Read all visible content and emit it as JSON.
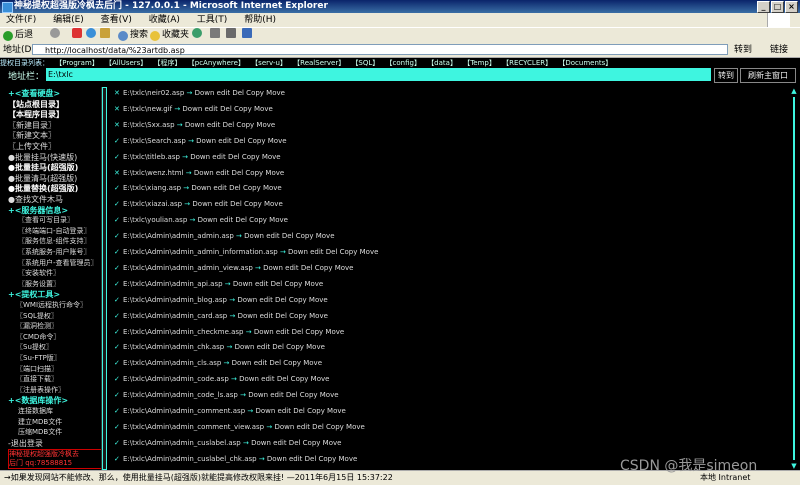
{
  "window": {
    "title": "神秘提权超强版冷枫去后门 - 127.0.0.1 - Microsoft Internet Explorer",
    "controls": [
      "_",
      "□",
      "×"
    ]
  },
  "menu": [
    "文件(F)",
    "编辑(E)",
    "查看(V)",
    "收藏(A)",
    "工具(T)",
    "帮助(H)"
  ],
  "toolbar": {
    "back": "后退",
    "search": "搜索",
    "favorites": "收藏夹"
  },
  "address": {
    "label": "地址(D)",
    "url": "http://localhost/data/%23artdb.asp",
    "go": "转到",
    "links": "链接"
  },
  "dirbar": {
    "label": "提权目录列表：",
    "items": [
      "【Program】",
      "【AllUsers】",
      "【程序】",
      "【pcAnywhere】",
      "【serv-u】",
      "【RealServer】",
      "【SQL】",
      "【config】",
      "【data】",
      "【Temp】",
      "【RECYCLER】",
      "【Documents】"
    ]
  },
  "pathbar": {
    "label": "地址栏：",
    "value": "E:\\txlc",
    "go": "转到",
    "refresh": "刷新主窗口"
  },
  "sidebar": {
    "items": [
      {
        "text": "+<查看硬盘>",
        "kind": "sec"
      },
      {
        "text": "【站点根目录】",
        "kind": "bold"
      },
      {
        "text": "【本程序目录】",
        "kind": "bold"
      },
      {
        "text": "〖新建目录〗",
        "kind": "item"
      },
      {
        "text": "〖新建文本〗",
        "kind": "item"
      },
      {
        "text": "〖上传文件〗",
        "kind": "item"
      },
      {
        "text": "●批量挂马(快速版)",
        "kind": "item"
      },
      {
        "text": "●批量挂马(超强版)",
        "kind": "bold"
      },
      {
        "text": "●批量清马(超强版)",
        "kind": "item"
      },
      {
        "text": "●批量替换(超强版)",
        "kind": "bold"
      },
      {
        "text": "●查找文件木马",
        "kind": "item"
      },
      {
        "text": "+<服务器信息>",
        "kind": "sec"
      },
      {
        "text": "〖查看可写目录〗",
        "kind": "sub"
      },
      {
        "text": "〖终端端口-自动登录〗",
        "kind": "sub"
      },
      {
        "text": "〖服务信息-组件支持〗",
        "kind": "sub"
      },
      {
        "text": "〖系统服务-用户账号〗",
        "kind": "sub"
      },
      {
        "text": "〖系统用户-查看管理员〗",
        "kind": "sub"
      },
      {
        "text": "〖安装软件〗",
        "kind": "sub"
      },
      {
        "text": "〖服务设置〗",
        "kind": "sub"
      },
      {
        "text": "+<提权工具>",
        "kind": "sec"
      },
      {
        "text": "〖WMI远程执行命令〗",
        "kind": "sub2"
      },
      {
        "text": "〖SQL提权〗",
        "kind": "sub2"
      },
      {
        "text": "〖漏洞检测〗",
        "kind": "sub2"
      },
      {
        "text": "〖CMD命令〗",
        "kind": "sub2"
      },
      {
        "text": "〖Su提权〗",
        "kind": "sub2"
      },
      {
        "text": "〖Su-FTP版〗",
        "kind": "sub2"
      },
      {
        "text": "〖端口扫描〗",
        "kind": "sub2"
      },
      {
        "text": "〖直接下载〗",
        "kind": "sub2"
      },
      {
        "text": "〖注册表操作〗",
        "kind": "sub2"
      },
      {
        "text": "+<数据库操作>",
        "kind": "sec"
      },
      {
        "text": "连接数据库",
        "kind": "sub"
      },
      {
        "text": "建立MDB文件",
        "kind": "sub"
      },
      {
        "text": "压缩MDB文件",
        "kind": "sub"
      },
      {
        "text": "-退出登录",
        "kind": "item"
      }
    ],
    "footer": [
      "神秘提权超强版冷枫去",
      "后门 qq:78588815"
    ]
  },
  "files": [
    {
      "mark": "✕",
      "path": "E:\\txlc\\neir02.asp",
      "ops": "Down edit Del Copy Move"
    },
    {
      "mark": "✕",
      "path": "E:\\txlc\\new.gif",
      "ops": "Down edit Del Copy Move"
    },
    {
      "mark": "✕",
      "path": "E:\\txlc\\Sxx.asp",
      "ops": "Down edit Del Copy Move"
    },
    {
      "mark": "✓",
      "path": "E:\\txlc\\Search.asp",
      "ops": "Down edit Del Copy Move"
    },
    {
      "mark": "✓",
      "path": "E:\\txlc\\titleb.asp",
      "ops": "Down edit Del Copy Move"
    },
    {
      "mark": "✕",
      "path": "E:\\txlc\\wenz.html",
      "ops": "Down edit Del Copy Move"
    },
    {
      "mark": "✓",
      "path": "E:\\txlc\\xiang.asp",
      "ops": "Down edit Del Copy Move"
    },
    {
      "mark": "✓",
      "path": "E:\\txlc\\xiazai.asp",
      "ops": "Down edit Del Copy Move"
    },
    {
      "mark": "✓",
      "path": "E:\\txlc\\youlian.asp",
      "ops": "Down edit Del Copy Move"
    },
    {
      "mark": "✓",
      "path": "E:\\txlc\\Admin\\admin_admin.asp",
      "ops": "Down edit Del Copy Move"
    },
    {
      "mark": "✓",
      "path": "E:\\txlc\\Admin\\admin_admin_information.asp",
      "ops": "Down edit Del Copy Move"
    },
    {
      "mark": "✓",
      "path": "E:\\txlc\\Admin\\admin_admin_view.asp",
      "ops": "Down edit Del Copy Move"
    },
    {
      "mark": "✓",
      "path": "E:\\txlc\\Admin\\admin_api.asp",
      "ops": "Down edit Del Copy Move"
    },
    {
      "mark": "✓",
      "path": "E:\\txlc\\Admin\\admin_blog.asp",
      "ops": "Down edit Del Copy Move"
    },
    {
      "mark": "✓",
      "path": "E:\\txlc\\Admin\\admin_card.asp",
      "ops": "Down edit Del Copy Move"
    },
    {
      "mark": "✓",
      "path": "E:\\txlc\\Admin\\admin_checkme.asp",
      "ops": "Down edit Del Copy Move"
    },
    {
      "mark": "✓",
      "path": "E:\\txlc\\Admin\\admin_chk.asp",
      "ops": "Down edit Del Copy Move"
    },
    {
      "mark": "✓",
      "path": "E:\\txlc\\Admin\\admin_cls.asp",
      "ops": "Down edit Del Copy Move"
    },
    {
      "mark": "✓",
      "path": "E:\\txlc\\Admin\\admin_code.asp",
      "ops": "Down edit Del Copy Move"
    },
    {
      "mark": "✓",
      "path": "E:\\txlc\\Admin\\admin_code_ls.asp",
      "ops": "Down edit Del Copy Move"
    },
    {
      "mark": "✓",
      "path": "E:\\txlc\\Admin\\admin_comment.asp",
      "ops": "Down edit Del Copy Move"
    },
    {
      "mark": "✓",
      "path": "E:\\txlc\\Admin\\admin_comment_view.asp",
      "ops": "Down edit Del Copy Move"
    },
    {
      "mark": "✓",
      "path": "E:\\txlc\\Admin\\admin_cuslabel.asp",
      "ops": "Down edit Del Copy Move"
    },
    {
      "mark": "✓",
      "path": "E:\\txlc\\Admin\\admin_cuslabel_chk.asp",
      "ops": "Down edit Del Copy Move"
    }
  ],
  "statusbar": {
    "message": "→如果发现网站不能修改、那么，使用批量挂马(超强版)就能提高修改权限来挂! —2011年6月15日 15:37:22",
    "zone": "本地 Intranet",
    "watermark": "CSDN @我是simeon"
  }
}
